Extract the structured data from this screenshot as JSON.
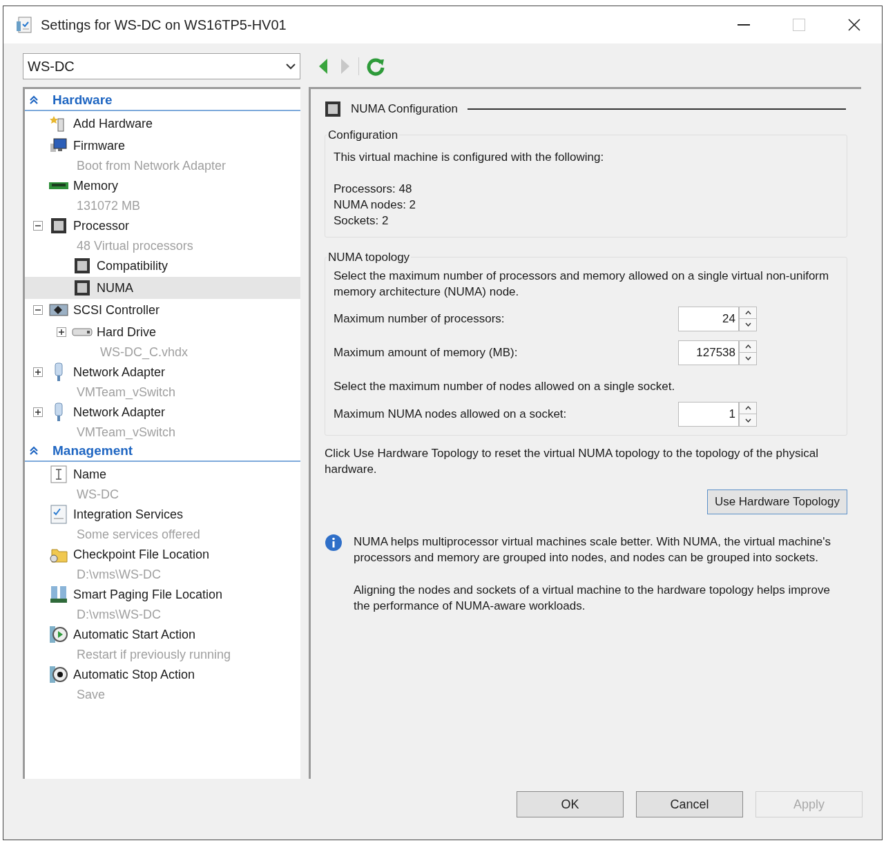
{
  "window": {
    "title": "Settings for WS-DC on WS16TP5-HV01"
  },
  "vm_selector": {
    "value": "WS-DC"
  },
  "navigation": {
    "back_disabled": false,
    "forward_disabled": true
  },
  "sidebar": {
    "sections": [
      {
        "title": "Hardware",
        "expanded": true,
        "items": [
          {
            "label": "Add Hardware",
            "kind": "add-hardware",
            "selected": false
          },
          {
            "label": "Firmware",
            "kind": "firmware",
            "detail": "Boot from Network Adapter",
            "selected": false
          },
          {
            "label": "Memory",
            "kind": "memory",
            "detail": "131072 MB",
            "selected": false
          },
          {
            "label": "Processor",
            "kind": "chip",
            "detail": "48 Virtual processors",
            "expanded": true,
            "selected": false,
            "children": [
              {
                "label": "Compatibility",
                "kind": "chip",
                "selected": false
              },
              {
                "label": "NUMA",
                "kind": "chip",
                "selected": true
              }
            ]
          },
          {
            "label": "SCSI Controller",
            "kind": "scsi",
            "expanded": true,
            "selected": false,
            "children": [
              {
                "label": "Hard Drive",
                "kind": "disk",
                "detail": "WS-DC_C.vhdx",
                "expanded": false,
                "selected": false
              }
            ]
          },
          {
            "label": "Network Adapter",
            "kind": "network",
            "detail": "VMTeam_vSwitch",
            "expanded": false,
            "selected": false
          },
          {
            "label": "Network Adapter",
            "kind": "network",
            "detail": "VMTeam_vSwitch",
            "expanded": false,
            "selected": false
          }
        ]
      },
      {
        "title": "Management",
        "expanded": true,
        "items": [
          {
            "label": "Name",
            "kind": "name",
            "detail": "WS-DC",
            "selected": false
          },
          {
            "label": "Integration Services",
            "kind": "integration",
            "detail": "Some services offered",
            "selected": false
          },
          {
            "label": "Checkpoint File Location",
            "kind": "checkpoint",
            "detail": "D:\\vms\\WS-DC",
            "selected": false
          },
          {
            "label": "Smart Paging File Location",
            "kind": "paging",
            "detail": "D:\\vms\\WS-DC",
            "selected": false
          },
          {
            "label": "Automatic Start Action",
            "kind": "start",
            "detail": "Restart if previously running",
            "selected": false
          },
          {
            "label": "Automatic Stop Action",
            "kind": "stop",
            "detail": "Save",
            "selected": false
          }
        ]
      }
    ]
  },
  "panel": {
    "title": "NUMA Configuration",
    "configuration": {
      "title": "Configuration",
      "intro": "This virtual machine is configured with the following:",
      "lines": [
        "Processors: 48",
        "NUMA nodes: 2",
        "Sockets: 2"
      ]
    },
    "topology": {
      "title": "NUMA topology",
      "description": "Select the maximum number of processors and memory allowed on a single virtual non-uniform memory architecture (NUMA) node.",
      "fields": [
        {
          "label": "Maximum number of processors:",
          "value": "24"
        },
        {
          "label": "Maximum amount of memory (MB):",
          "value": "127538"
        }
      ],
      "socket_description": "Select the maximum number of nodes allowed on a single socket.",
      "socket_fields": [
        {
          "label": "Maximum NUMA nodes allowed on a socket:",
          "value": "1"
        }
      ]
    },
    "reset_note": "Click Use Hardware Topology to reset the virtual NUMA topology to the topology of the physical hardware.",
    "reset_button": "Use Hardware Topology",
    "info": [
      "NUMA helps multiprocessor virtual machines scale better.  With NUMA, the virtual machine's processors and memory are grouped into nodes, and nodes can be grouped into sockets.",
      "Aligning the nodes and sockets of a virtual machine to the hardware topology helps improve the performance of NUMA-aware workloads."
    ]
  },
  "buttons": [
    {
      "label": "OK",
      "disabled": false
    },
    {
      "label": "Cancel",
      "disabled": false
    },
    {
      "label": "Apply",
      "disabled": true
    }
  ]
}
